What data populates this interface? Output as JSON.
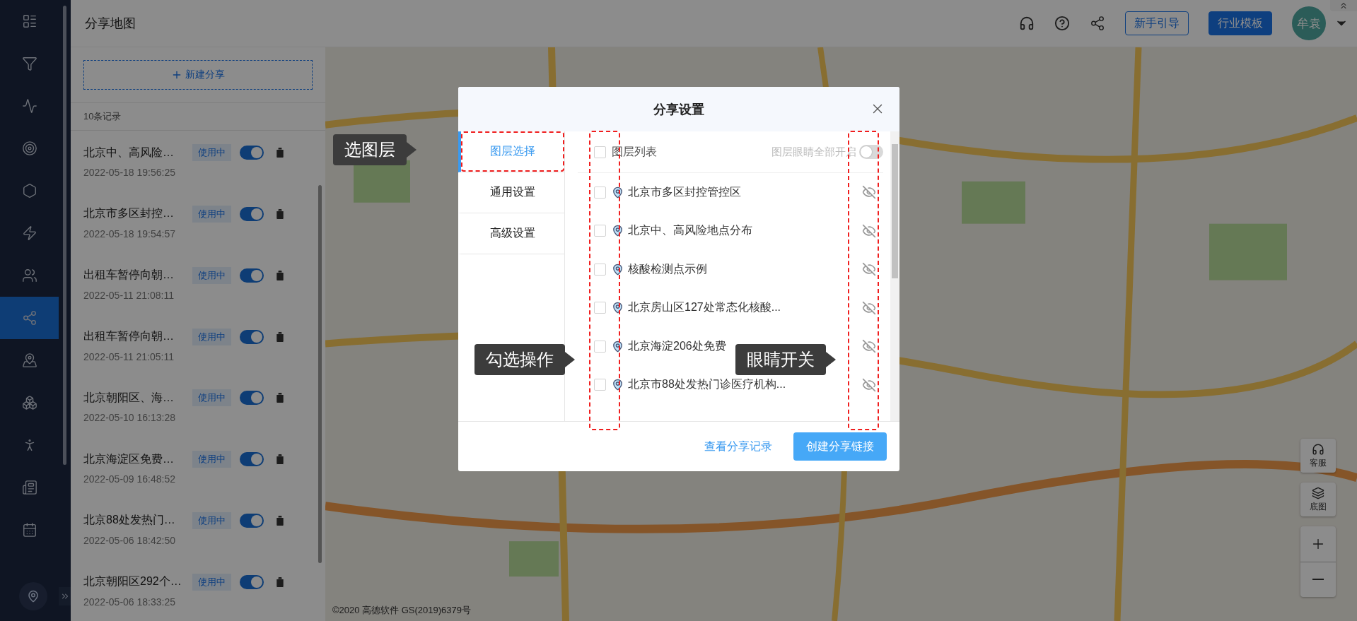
{
  "nav": [
    {
      "selected": false
    },
    {
      "selected": false
    },
    {
      "selected": false
    },
    {
      "selected": false
    },
    {
      "selected": false
    },
    {
      "selected": false
    },
    {
      "selected": false
    },
    {
      "selected": true
    },
    {
      "selected": false
    },
    {
      "selected": false
    },
    {
      "selected": false
    },
    {
      "selected": false
    },
    {
      "selected": false
    }
  ],
  "page_title": "分享地图",
  "header": {
    "buttons": [
      {
        "label": "新手引导",
        "kind": "outline"
      },
      {
        "label": "行业模板",
        "kind": "solid"
      }
    ],
    "user": "牟袁"
  },
  "new_share_button": "新建分享",
  "record_count": "10条记录",
  "shares": [
    {
      "title": "北京中、高风险…",
      "time": "2022-05-18 19:56:25",
      "status": "使用中",
      "on": true
    },
    {
      "title": "北京市多区封控…",
      "time": "2022-05-18 19:54:57",
      "status": "使用中",
      "on": true
    },
    {
      "title": "出租车暂停向朝…",
      "time": "2022-05-11 21:08:11",
      "status": "使用中",
      "on": true
    },
    {
      "title": "出租车暂停向朝…",
      "time": "2022-05-11 21:05:11",
      "status": "使用中",
      "on": true
    },
    {
      "title": "北京朝阳区、海…",
      "time": "2022-05-10 16:13:28",
      "status": "使用中",
      "on": true
    },
    {
      "title": "北京海淀区免费…",
      "time": "2022-05-09 16:48:52",
      "status": "使用中",
      "on": true
    },
    {
      "title": "北京88处发热门…",
      "time": "2022-05-06 18:42:50",
      "status": "使用中",
      "on": true
    },
    {
      "title": "北京朝阳区292个…",
      "time": "2022-05-06 18:33:25",
      "status": "使用中",
      "on": true
    }
  ],
  "map": {
    "attribution": "©2020 高德软件 GS(2019)6379号",
    "controls": [
      {
        "label": "客服",
        "kind": "service"
      },
      {
        "label": "底图",
        "kind": "basemap"
      }
    ]
  },
  "dialog": {
    "title": "分享设置",
    "tabs": [
      {
        "label": "图层选择",
        "selected": true
      },
      {
        "label": "通用设置",
        "selected": false
      },
      {
        "label": "高级设置",
        "selected": false
      }
    ],
    "list_header": {
      "label": "图层列表",
      "checked": false
    },
    "eye_all": {
      "label": "图层眼睛全部开启",
      "on": false
    },
    "layers": [
      {
        "name": "北京市多区封控管控区",
        "checked": false,
        "visible": false
      },
      {
        "name": "北京中、高风险地点分布",
        "checked": false,
        "visible": false
      },
      {
        "name": "核酸检测点示例",
        "checked": false,
        "visible": false
      },
      {
        "name": "北京房山区127处常态化核酸...",
        "checked": false,
        "visible": false
      },
      {
        "name": "北京海淀206处免费",
        "checked": false,
        "visible": false
      },
      {
        "name": "北京市88处发热门诊医疗机构...",
        "checked": false,
        "visible": false
      }
    ],
    "footer_link": "查看分享记录",
    "primary_button": "创建分享链接"
  },
  "annotations": [
    {
      "text": "选图层"
    },
    {
      "text": "勾选操作"
    },
    {
      "text": "眼睛开关"
    }
  ]
}
